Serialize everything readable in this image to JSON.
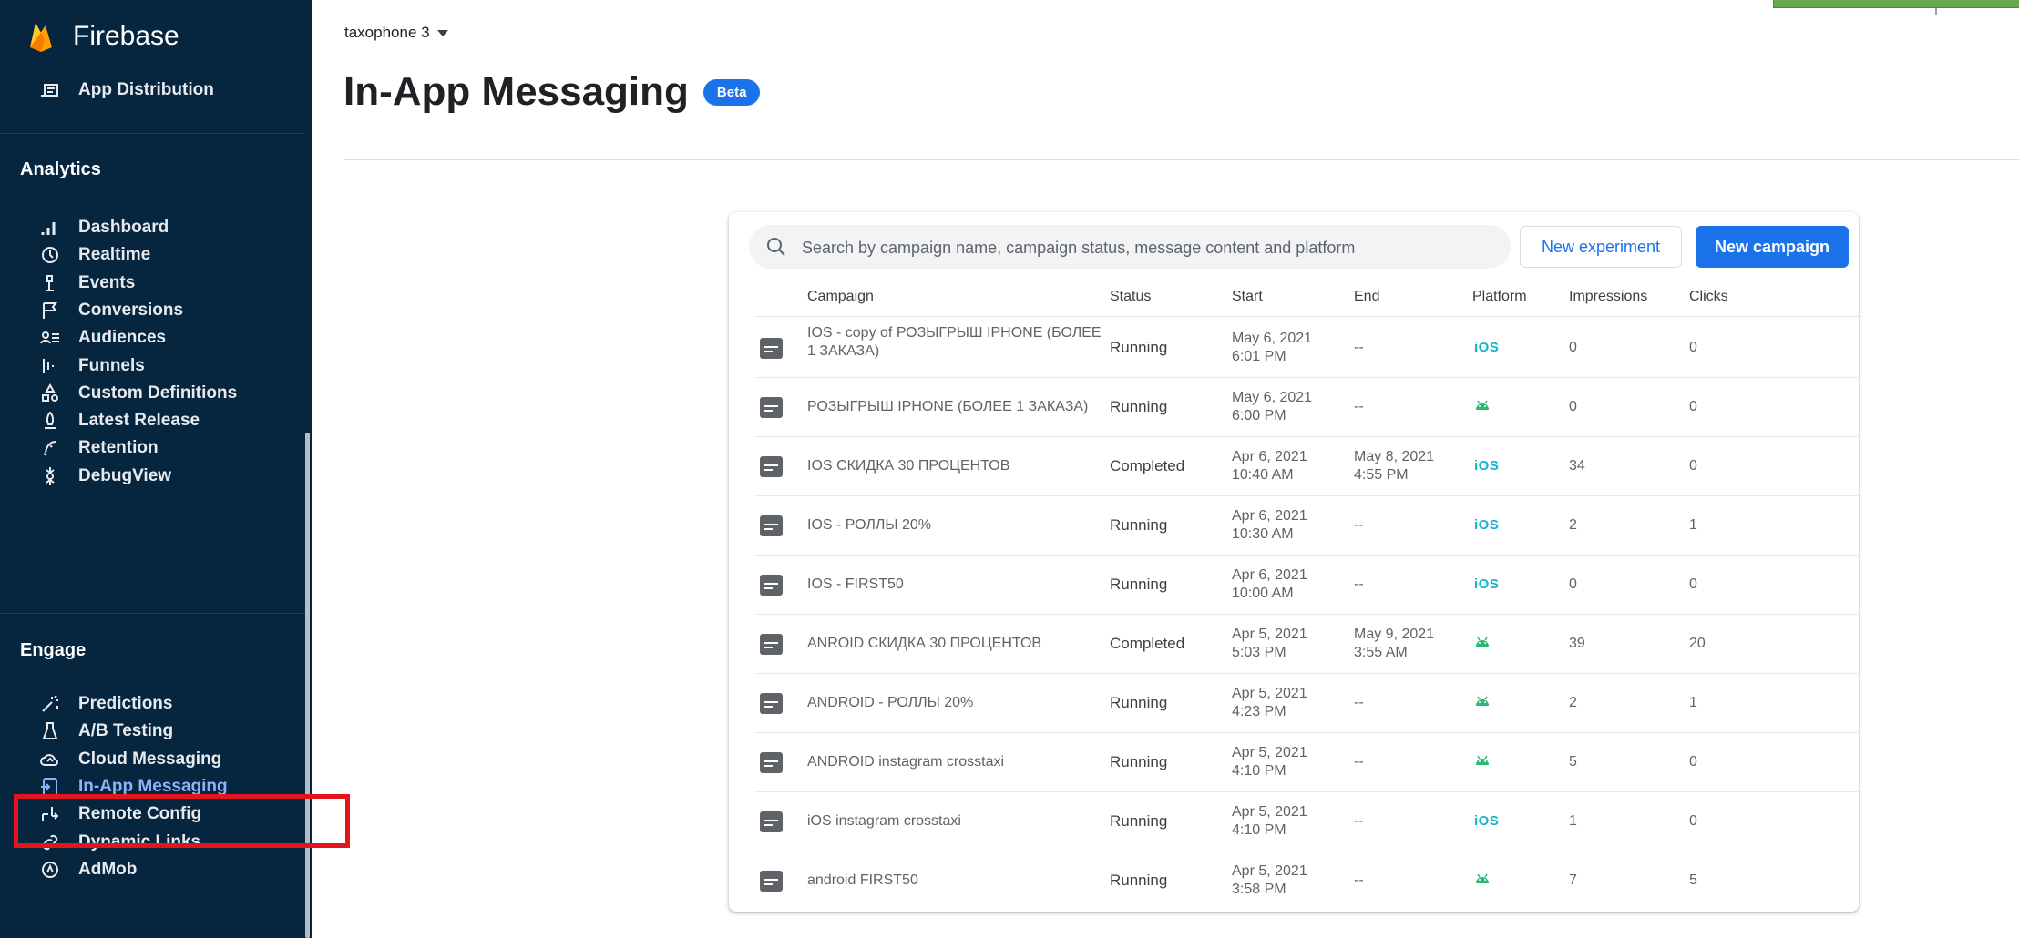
{
  "sidebar": {
    "brand": "Firebase",
    "top_item": {
      "label": "App Distribution",
      "icon": "app-distribution-icon"
    },
    "analytics_header": "Analytics",
    "analytics_items": [
      {
        "label": "Dashboard",
        "icon": "dashboard-icon"
      },
      {
        "label": "Realtime",
        "icon": "realtime-icon"
      },
      {
        "label": "Events",
        "icon": "events-icon"
      },
      {
        "label": "Conversions",
        "icon": "conversions-icon"
      },
      {
        "label": "Audiences",
        "icon": "audiences-icon"
      },
      {
        "label": "Funnels",
        "icon": "funnels-icon"
      },
      {
        "label": "Custom Definitions",
        "icon": "custom-definitions-icon"
      },
      {
        "label": "Latest Release",
        "icon": "latest-release-icon"
      },
      {
        "label": "Retention",
        "icon": "retention-icon"
      },
      {
        "label": "DebugView",
        "icon": "debugview-icon"
      }
    ],
    "engage_header": "Engage",
    "engage_items": [
      {
        "label": "Predictions",
        "icon": "predictions-icon"
      },
      {
        "label": "A/B Testing",
        "icon": "ab-testing-icon"
      },
      {
        "label": "Cloud Messaging",
        "icon": "cloud-messaging-icon"
      },
      {
        "label": "In-App Messaging",
        "icon": "in-app-messaging-icon",
        "active": true
      },
      {
        "label": "Remote Config",
        "icon": "remote-config-icon"
      },
      {
        "label": "Dynamic Links",
        "icon": "dynamic-links-icon"
      },
      {
        "label": "AdMob",
        "icon": "admob-icon"
      }
    ]
  },
  "header": {
    "project": "taxophone 3",
    "title": "In-App Messaging",
    "badge": "Beta"
  },
  "toolbar": {
    "search_placeholder": "Search by campaign name, campaign status, message content and platform",
    "new_experiment": "New experiment",
    "new_campaign": "New campaign"
  },
  "table": {
    "columns": [
      "Campaign",
      "Status",
      "Start",
      "End",
      "Platform",
      "Impressions",
      "Clicks"
    ],
    "rows": [
      {
        "campaign": "IOS - copy of РОЗЫГРЫШ IPHONE (БОЛЕЕ 1 ЗАКАЗА)",
        "status": "Running",
        "start_date": "May 6, 2021",
        "start_time": "6:01 PM",
        "end_date": "--",
        "end_time": "",
        "platform": "ios",
        "impressions": "0",
        "clicks": "0"
      },
      {
        "campaign": "РОЗЫГРЫШ IPHONE (БОЛЕЕ 1 ЗАКАЗА)",
        "status": "Running",
        "start_date": "May 6, 2021",
        "start_time": "6:00 PM",
        "end_date": "--",
        "end_time": "",
        "platform": "android",
        "impressions": "0",
        "clicks": "0"
      },
      {
        "campaign": "IOS СКИДКА 30 ПРОЦЕНТОВ",
        "status": "Completed",
        "start_date": "Apr 6, 2021",
        "start_time": "10:40 AM",
        "end_date": "May 8, 2021",
        "end_time": "4:55 PM",
        "platform": "ios",
        "impressions": "34",
        "clicks": "0"
      },
      {
        "campaign": "IOS - РОЛЛЫ 20%",
        "status": "Running",
        "start_date": "Apr 6, 2021",
        "start_time": "10:30 AM",
        "end_date": "--",
        "end_time": "",
        "platform": "ios",
        "impressions": "2",
        "clicks": "1"
      },
      {
        "campaign": "IOS - FIRST50",
        "status": "Running",
        "start_date": "Apr 6, 2021",
        "start_time": "10:00 AM",
        "end_date": "--",
        "end_time": "",
        "platform": "ios",
        "impressions": "0",
        "clicks": "0"
      },
      {
        "campaign": "ANROID СКИДКА 30 ПРОЦЕНТОВ",
        "status": "Completed",
        "start_date": "Apr 5, 2021",
        "start_time": "5:03 PM",
        "end_date": "May 9, 2021",
        "end_time": "3:55 AM",
        "platform": "android",
        "impressions": "39",
        "clicks": "20"
      },
      {
        "campaign": "ANDROID - РОЛЛЫ 20%",
        "status": "Running",
        "start_date": "Apr 5, 2021",
        "start_time": "4:23 PM",
        "end_date": "--",
        "end_time": "",
        "platform": "android",
        "impressions": "2",
        "clicks": "1"
      },
      {
        "campaign": "ANDROID instagram crosstaxi",
        "status": "Running",
        "start_date": "Apr 5, 2021",
        "start_time": "4:10 PM",
        "end_date": "--",
        "end_time": "",
        "platform": "android",
        "impressions": "5",
        "clicks": "0"
      },
      {
        "campaign": "iOS instagram crosstaxi",
        "status": "Running",
        "start_date": "Apr 5, 2021",
        "start_time": "4:10 PM",
        "end_date": "--",
        "end_time": "",
        "platform": "ios",
        "impressions": "1",
        "clicks": "0"
      },
      {
        "campaign": "android FIRST50",
        "status": "Running",
        "start_date": "Apr 5, 2021",
        "start_time": "3:58 PM",
        "end_date": "--",
        "end_time": "",
        "platform": "android",
        "impressions": "7",
        "clicks": "5"
      }
    ]
  },
  "platform_labels": {
    "ios": "iOS"
  },
  "colors": {
    "sidebar_bg": "#06253f",
    "accent": "#1a73e8",
    "active_nav": "#8ab4f8",
    "highlight": "#e3141b",
    "ios": "#12b5cb",
    "android": "#2bb673"
  }
}
